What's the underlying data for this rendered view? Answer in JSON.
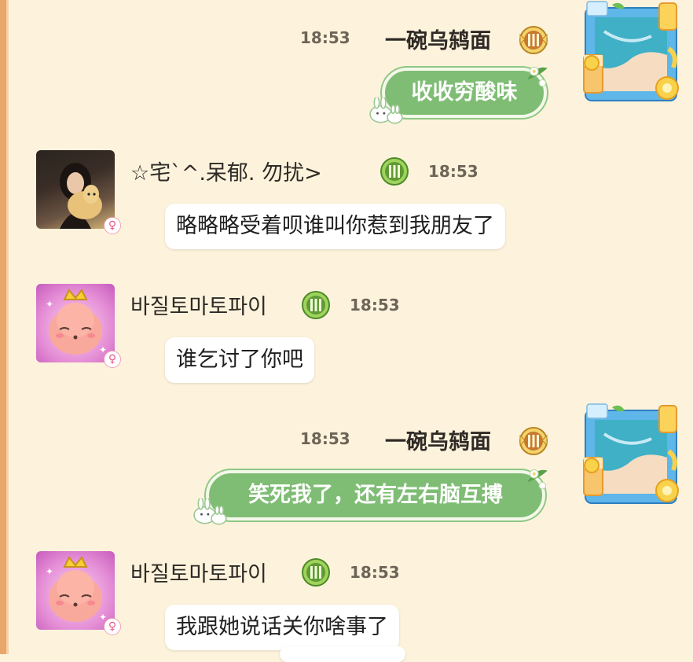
{
  "messages": [
    {
      "side": "right",
      "time": "18:53",
      "name": "一碗乌鸫面",
      "text": "收收穷酸味"
    },
    {
      "side": "left",
      "time": "18:53",
      "name": "☆宅`^.呆郁. 勿扰>",
      "text": "略略略受着呗谁叫你惹到我朋友了",
      "gender": "♀"
    },
    {
      "side": "left",
      "time": "18:53",
      "name": "바질토마토파이",
      "text": "谁乞讨了你吧",
      "gender": "♀"
    },
    {
      "side": "right",
      "time": "18:53",
      "name": "一碗乌鸫面",
      "text": "笑死我了，还有左右脑互搏"
    },
    {
      "side": "left",
      "time": "18:53",
      "name": "바질토마토파이",
      "text": "我跟她说话关你啥事了",
      "gender": "♀"
    }
  ],
  "icons": {
    "level_badge_gold": "level-badge-gold-icon",
    "level_badge_green": "level-badge-green-icon",
    "bunny": "bunny-icon",
    "flower": "flower-icon",
    "gender": "female-icon"
  },
  "colors": {
    "background": "#fdf3dc",
    "green_bubble": "#7fbd75",
    "white_bubble": "#ffffff",
    "gender": "#e65a8a"
  }
}
